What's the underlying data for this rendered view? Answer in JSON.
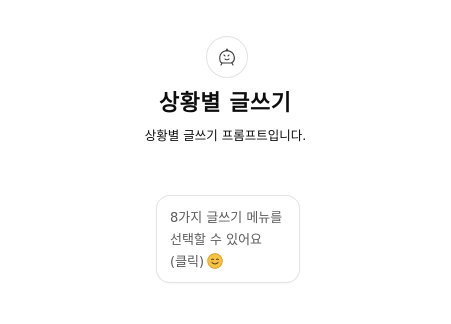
{
  "gpt": {
    "avatar_icon": "hand-drawn-creature-icon",
    "name": "상황별 글쓰기",
    "description": "상황별 글쓰기 프롬프트입니다."
  },
  "conversation_starters": [
    {
      "text": "8가지 글쓰기 메뉴를 선택할 수 있어요 (클릭)",
      "emoji_icon": "smiling-face-emoji"
    }
  ],
  "colors": {
    "background": "#ffffff",
    "title": "#0d0d0d",
    "starter_text": "#5d5d5d",
    "border": "#e3e3e3",
    "emoji": "#f5c542"
  }
}
